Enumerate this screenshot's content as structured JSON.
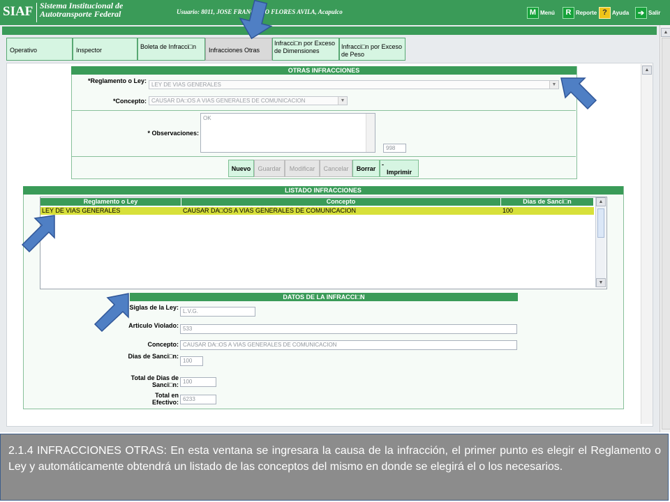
{
  "app": {
    "logo": "SIAF",
    "system_title_line1": "Sistema Institucional de",
    "system_title_line2": "Autotransporte Federal",
    "user_line": "Usuario: 8011, JOSE FRANCISCO FLORES AVILA, Acapulco"
  },
  "menu": [
    {
      "letter": "M",
      "label": "Menú"
    },
    {
      "letter": "R",
      "label": "Reporte"
    },
    {
      "letter": "?",
      "label": "Ayuda"
    },
    {
      "letter": "➔",
      "label": "Salir"
    }
  ],
  "tabs": [
    {
      "label": "Operativo"
    },
    {
      "label": "Inspector"
    },
    {
      "label": "Boleta de Infracci□n"
    },
    {
      "label": "Infracciones Otras"
    },
    {
      "label": "Infracci□n por Exceso de Dimensiones"
    },
    {
      "label": "Infracci□n por Exceso de Peso"
    }
  ],
  "otras": {
    "header": "OTRAS INFRACCIONES",
    "reglamento_label": "*Reglamento o Ley:",
    "reglamento_value": "LEY DE VIAS GENERALES",
    "concepto_label": "*Concepto:",
    "concepto_value": "CAUSAR DA□OS A VIAS GENERALES DE COMUNICACION",
    "observaciones_label": "* Observaciones:",
    "observaciones_value": "OK",
    "char_count": "998"
  },
  "buttons": {
    "nuevo": "Nuevo",
    "guardar": "Guardar",
    "modificar": "Modificar",
    "cancelar": "Cancelar",
    "borrar": "Borrar",
    "imprimir_dash": "-",
    "imprimir": "Imprimir"
  },
  "listado": {
    "header": "LISTADO INFRACCIONES",
    "columns": [
      "Reglamento o Ley",
      "Concepto",
      "Dias de Sanci□n"
    ],
    "rows": [
      [
        "LEY DE VIAS GENERALES",
        "CAUSAR DA□OS A VIAS GENERALES DE COMUNICACION",
        "100"
      ]
    ]
  },
  "datos": {
    "header": "DATOS DE LA INFRACCI□N",
    "siglas_label": "Siglas de la Ley:",
    "siglas_value": "L.V.G.",
    "articulo_label": "Articulo Violado:",
    "articulo_value": "533",
    "concepto_label": "Concepto:",
    "concepto_value": "CAUSAR DA□OS A VIAS GENERALES DE COMUNICACION",
    "dias_label": "Dias de Sanci□n:",
    "dias_value": "100",
    "total_dias_label": "Total de Dias de Sanci□n:",
    "total_dias_value": "100",
    "total_efectivo_label": "Total en Efectivo:",
    "total_efectivo_value": "6233"
  },
  "caption": "2.1.4 INFRACCIONES OTRAS: En esta ventana se ingresara la causa de la infracción, el primer punto es elegir el Reglamento o Ley y  automáticamente obtendrá un listado de las conceptos del mismo en donde se elegirá el o los  necesarios.",
  "colors": {
    "brand_green": "#3a9b58",
    "tab_bg": "#d6f5e2",
    "row_highlight": "#d7e03a",
    "arrow_blue": "#4f7fc4"
  }
}
